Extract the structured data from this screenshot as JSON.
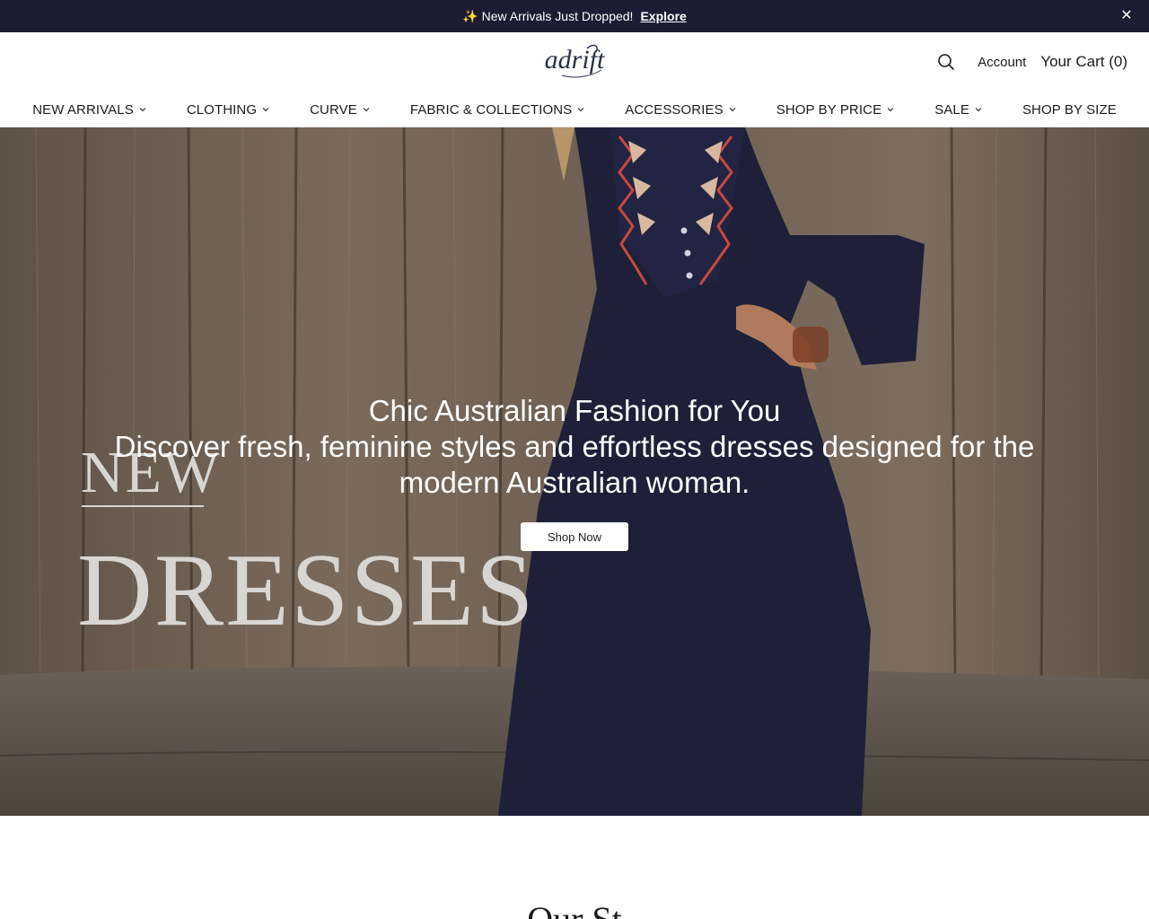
{
  "announcement": {
    "icon": "sparkles-icon",
    "message": "New Arrivals Just Dropped!",
    "link": "Explore",
    "close_icon": "close-icon",
    "bg_color": "#1c1c33"
  },
  "header": {
    "logo_text": "adrift",
    "search_icon": "search-icon",
    "account_label": "Account",
    "cart_label": "Your Cart (0)"
  },
  "nav": {
    "items": [
      {
        "label": "NEW ARRIVALS",
        "has_dropdown": true
      },
      {
        "label": "CLOTHING",
        "has_dropdown": true
      },
      {
        "label": "CURVE",
        "has_dropdown": true
      },
      {
        "label": "FABRIC & COLLECTIONS",
        "has_dropdown": true
      },
      {
        "label": "ACCESSORIES",
        "has_dropdown": true
      },
      {
        "label": "SHOP BY PRICE",
        "has_dropdown": true
      },
      {
        "label": "SALE",
        "has_dropdown": true
      },
      {
        "label": "SHOP BY SIZE",
        "has_dropdown": false
      }
    ]
  },
  "hero": {
    "overlay_new": "NEW",
    "overlay_dresses": "DRESSES",
    "title": "Chic Australian Fashion for You",
    "subtitle": "Discover fresh, feminine styles and effortless dresses designed for the modern Australian woman.",
    "button_label": "Shop Now"
  },
  "next_section": {
    "heading_partial": "Our St"
  }
}
